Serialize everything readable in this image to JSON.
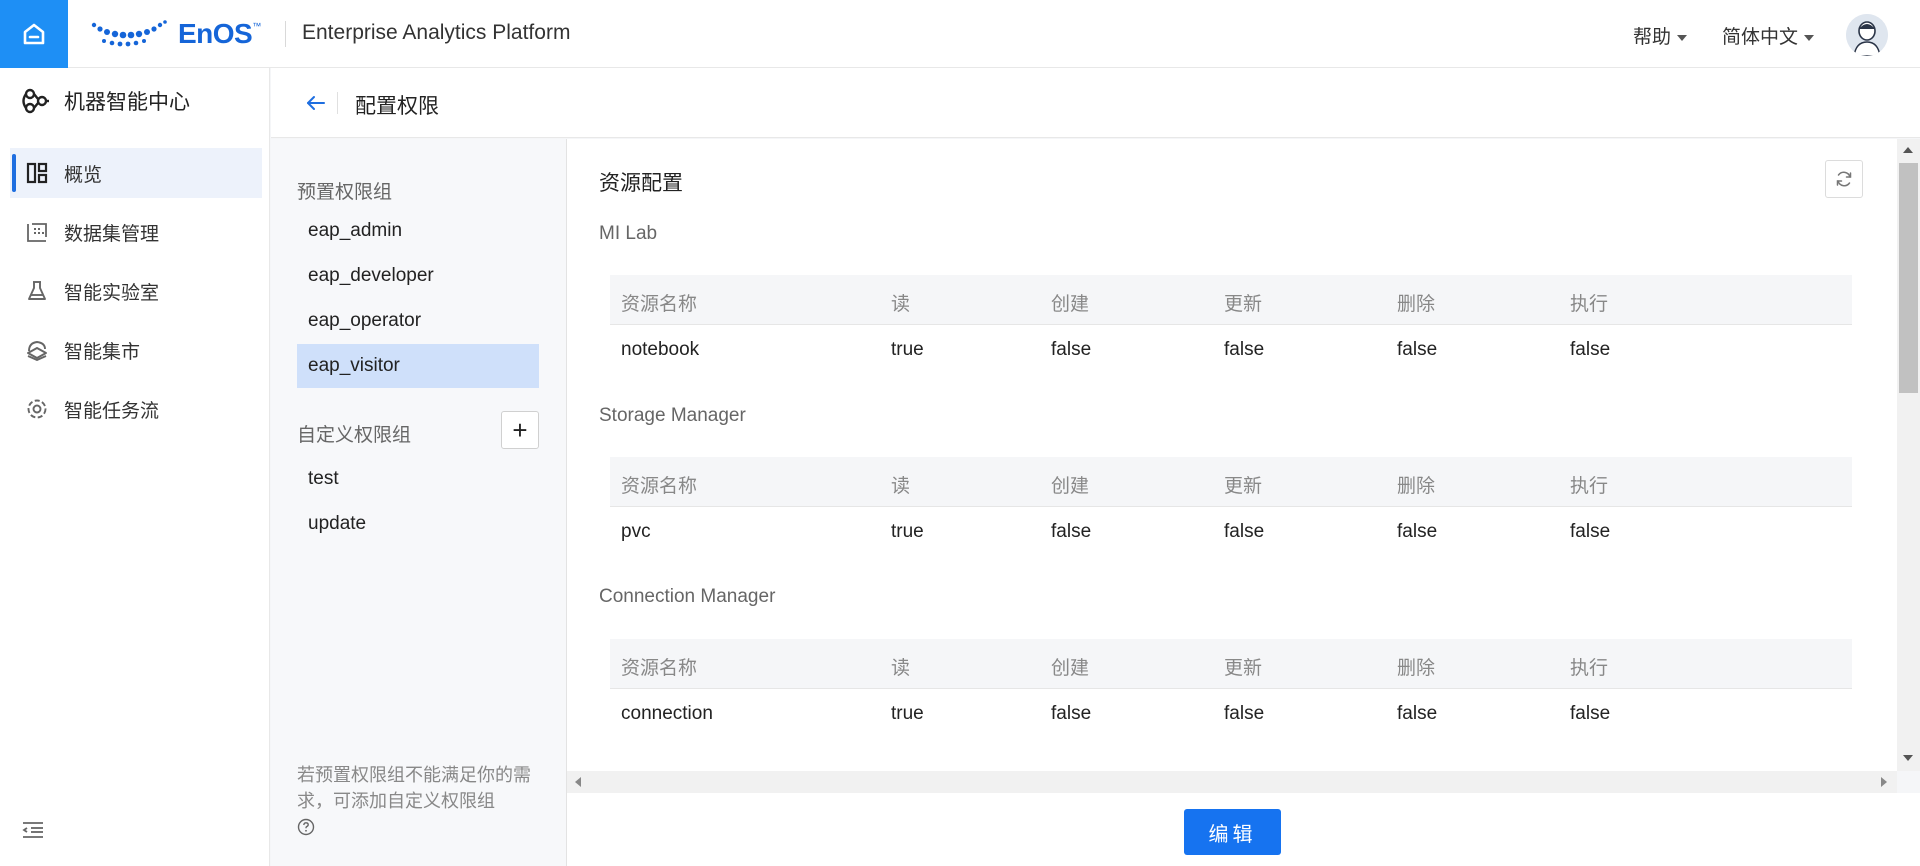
{
  "topbar": {
    "brand": "EnOS",
    "brand_tm": "™",
    "app_title": "Enterprise Analytics Platform",
    "help_label": "帮助",
    "language_label": "简体中文",
    "accent_color": "#1e8ff5"
  },
  "sidebar": {
    "title": "机器智能中心",
    "items": [
      {
        "label": "概览",
        "icon": "dashboard-icon",
        "active": true
      },
      {
        "label": "数据集管理",
        "icon": "dataset-icon",
        "active": false
      },
      {
        "label": "智能实验室",
        "icon": "flask-icon",
        "active": false
      },
      {
        "label": "智能集市",
        "icon": "market-icon",
        "active": false
      },
      {
        "label": "智能任务流",
        "icon": "workflow-icon",
        "active": false
      }
    ]
  },
  "page": {
    "title": "配置权限"
  },
  "groups": {
    "preset_heading": "预置权限组",
    "preset": [
      "eap_admin",
      "eap_developer",
      "eap_operator",
      "eap_visitor"
    ],
    "selected": "eap_visitor",
    "custom_heading": "自定义权限组",
    "custom": [
      "test",
      "update"
    ],
    "add_label": "+",
    "note": "若预置权限组不能满足你的需求，可添加自定义权限组"
  },
  "resources": {
    "title": "资源配置",
    "columns": [
      "资源名称",
      "读",
      "创建",
      "更新",
      "删除",
      "执行"
    ],
    "groups": [
      {
        "name": "MI Lab",
        "rows": [
          [
            "notebook",
            "true",
            "false",
            "false",
            "false",
            "false"
          ]
        ]
      },
      {
        "name": "Storage Manager",
        "rows": [
          [
            "pvc",
            "true",
            "false",
            "false",
            "false",
            "false"
          ]
        ]
      },
      {
        "name": "Connection Manager",
        "rows": [
          [
            "connection",
            "true",
            "false",
            "false",
            "false",
            "false"
          ]
        ]
      }
    ]
  },
  "footer": {
    "edit_label": "编辑"
  }
}
